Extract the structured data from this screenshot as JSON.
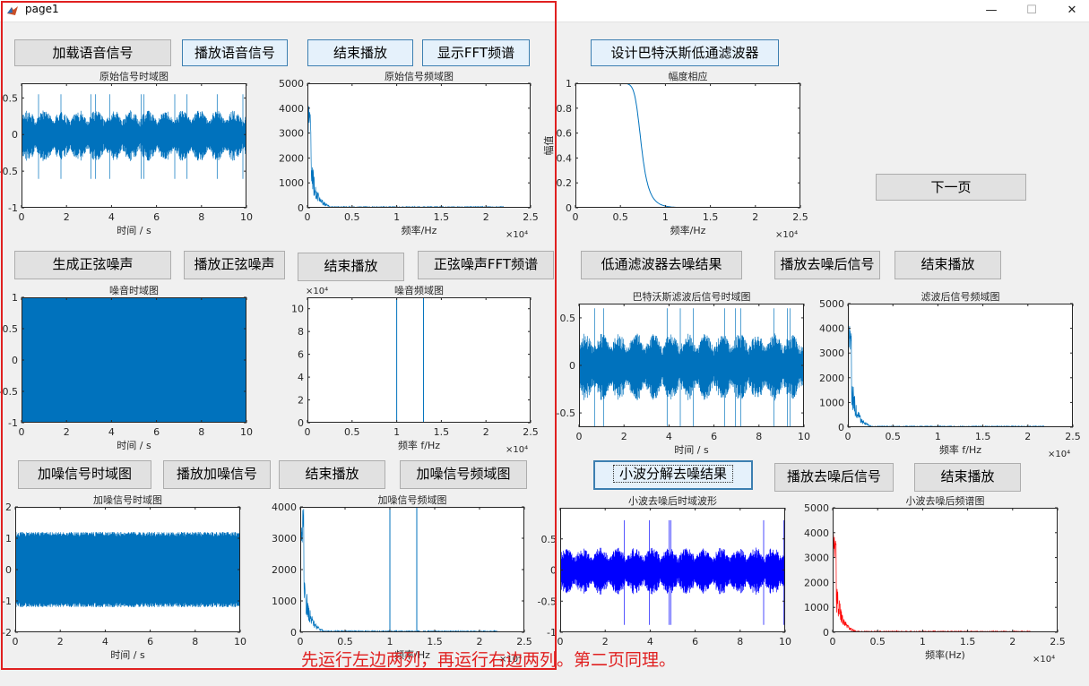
{
  "window": {
    "title": "page1",
    "minimize": "—",
    "maximize": "☐",
    "close": "✕"
  },
  "buttons": {
    "load_speech": "加载语音信号",
    "play_speech": "播放语音信号",
    "stop_1": "结束播放",
    "show_fft": "显示FFT频谱",
    "design_butter": "设计巴特沃斯低通滤波器",
    "next_page": "下一页",
    "gen_sine": "生成正弦噪声",
    "play_sine": "播放正弦噪声",
    "stop_2": "结束播放",
    "sine_fft": "正弦噪声FFT频谱",
    "lowpass_result": "低通滤波器去噪结果",
    "play_denoised_1": "播放去噪后信号",
    "stop_3": "结束播放",
    "noisy_time": "加噪信号时域图",
    "play_noisy": "播放加噪信号",
    "stop_4": "结束播放",
    "noisy_freq": "加噪信号频域图",
    "wavelet_result": "小波分解去噪结果",
    "play_denoised_2": "播放去噪后信号",
    "stop_5": "结束播放"
  },
  "note": "先运行左边两列，再运行右边两列。第二页同理。",
  "colors": {
    "matlab_blue": "#0072bd",
    "pure_blue": "#0000ff",
    "red": "#ff0000",
    "annotation": "#e02020"
  },
  "chart_data": [
    {
      "id": "orig_time",
      "type": "line",
      "title": "原始信号时域图",
      "xlabel": "时间 / s",
      "ylabel": "",
      "xlim": [
        0,
        10
      ],
      "ylim": [
        -1,
        0.7
      ],
      "xticks": [
        "0",
        "2",
        "4",
        "6",
        "8",
        "10"
      ],
      "yticks": [
        "0.5",
        "0",
        "-0.5",
        "-1"
      ],
      "signal": {
        "kind": "speech",
        "amp": 0.28,
        "spike": 0.55
      }
    },
    {
      "id": "orig_freq",
      "type": "line",
      "title": "原始信号频域图",
      "xlabel": "频率/Hz",
      "ylabel": "",
      "xlim": [
        0,
        25000
      ],
      "ylim": [
        0,
        5000
      ],
      "xticks": [
        "0",
        "0.5",
        "1",
        "1.5",
        "2",
        "2.5"
      ],
      "yticks": [
        "5000",
        "4000",
        "3000",
        "2000",
        "1000",
        "0"
      ],
      "x_exponent": "×10⁴",
      "signal": {
        "kind": "spectrum",
        "peak": 4100
      }
    },
    {
      "id": "mag_response",
      "type": "line",
      "title": "幅度相应",
      "xlabel": "频率/Hz",
      "ylabel": "幅值",
      "xlim": [
        0,
        25000
      ],
      "ylim": [
        0,
        1
      ],
      "xticks": [
        "0",
        "0.5",
        "1",
        "1.5",
        "2",
        "2.5"
      ],
      "yticks": [
        "1",
        "0.8",
        "0.6",
        "0.4",
        "0.2",
        "0"
      ],
      "x_exponent": "×10⁴",
      "signal": {
        "kind": "butter",
        "cutoff": 7000
      }
    },
    {
      "id": "noise_time",
      "type": "area",
      "title": "噪音时域图",
      "xlabel": "时间 / s",
      "ylabel": "",
      "xlim": [
        0,
        10
      ],
      "ylim": [
        -1,
        1
      ],
      "xticks": [
        "0",
        "2",
        "4",
        "6",
        "8",
        "10"
      ],
      "yticks": [
        "1",
        "0.5",
        "0",
        "-0.5",
        "-1"
      ],
      "signal": {
        "kind": "fill"
      }
    },
    {
      "id": "noise_freq",
      "type": "line",
      "title": "噪音频域图",
      "xlabel": "频率 f/Hz",
      "ylabel": "",
      "xlim": [
        0,
        25000
      ],
      "ylim": [
        0,
        110000
      ],
      "xticks": [
        "0",
        "0.5",
        "1",
        "1.5",
        "2",
        "2.5"
      ],
      "yticks": [
        "10",
        "8",
        "6",
        "4",
        "2",
        "0"
      ],
      "x_exponent": "×10⁴",
      "y_exponent": "×10⁴",
      "signal": {
        "kind": "lines",
        "x": [
          10000,
          13000
        ],
        "peak": 110000
      }
    },
    {
      "id": "butter_time",
      "type": "line",
      "title": "巴特沃斯滤波后信号时域图",
      "xlabel": "时间 / s",
      "ylabel": "",
      "xlim": [
        0,
        10
      ],
      "ylim": [
        -0.65,
        0.65
      ],
      "xticks": [
        "0",
        "2",
        "4",
        "6",
        "8",
        "10"
      ],
      "yticks": [
        "0.5",
        "0",
        "-0.5"
      ],
      "signal": {
        "kind": "speech",
        "amp": 0.28,
        "spike": 0.6
      }
    },
    {
      "id": "butter_freq",
      "type": "line",
      "title": "滤波后信号频域图",
      "xlabel": "频率 f/Hz",
      "ylabel": "",
      "xlim": [
        0,
        25000
      ],
      "ylim": [
        0,
        5000
      ],
      "xticks": [
        "0",
        "0.5",
        "1",
        "1.5",
        "2",
        "2.5"
      ],
      "yticks": [
        "5000",
        "4000",
        "3000",
        "2000",
        "1000",
        "0"
      ],
      "x_exponent": "×10⁴",
      "signal": {
        "kind": "spectrum",
        "peak": 4100
      }
    },
    {
      "id": "noisy_time",
      "type": "line",
      "title": "加噪信号时域图",
      "xlabel": "时间 / s",
      "ylabel": "",
      "xlim": [
        0,
        10
      ],
      "ylim": [
        -2,
        2
      ],
      "xticks": [
        "0",
        "2",
        "4",
        "6",
        "8",
        "10"
      ],
      "yticks": [
        "2",
        "1",
        "0",
        "-1",
        "-2"
      ],
      "signal": {
        "kind": "noisy"
      }
    },
    {
      "id": "noisy_freq",
      "type": "line",
      "title": "加噪信号频域图",
      "xlabel": "频率/Hz",
      "ylabel": "",
      "xlim": [
        0,
        25000
      ],
      "ylim": [
        0,
        4000
      ],
      "xticks": [
        "0",
        "0.5",
        "1",
        "1.5",
        "2",
        "2.5"
      ],
      "yticks": [
        "4000",
        "3000",
        "2000",
        "1000",
        "0"
      ],
      "x_exponent": "×10⁴",
      "signal": {
        "kind": "spectrum_lines",
        "peak": 4000,
        "x": [
          10000,
          13000
        ]
      }
    },
    {
      "id": "wavelet_time",
      "type": "line",
      "title": "小波去噪后时域波形",
      "xlabel": "",
      "ylabel": "",
      "xlim": [
        0,
        10
      ],
      "ylim": [
        -1,
        1
      ],
      "xticks": [
        "0",
        "2",
        "4",
        "6",
        "8",
        "10"
      ],
      "yticks": [
        "0.5",
        "0",
        "-0.5",
        "-1"
      ],
      "color": "#0000ff",
      "signal": {
        "kind": "speech",
        "amp": 0.3,
        "spike": 0.8
      }
    },
    {
      "id": "wavelet_freq",
      "type": "line",
      "title": "小波去噪后频谱图",
      "xlabel": "频率(Hz)",
      "ylabel": "",
      "xlim": [
        0,
        25000
      ],
      "ylim": [
        0,
        5000
      ],
      "xticks": [
        "0",
        "0.5",
        "1",
        "1.5",
        "2",
        "2.5"
      ],
      "yticks": [
        "5000",
        "4000",
        "3000",
        "2000",
        "1000",
        "0"
      ],
      "x_exponent": "×10⁴",
      "color": "#ff0000",
      "signal": {
        "kind": "spectrum",
        "peak": 4100
      }
    }
  ]
}
